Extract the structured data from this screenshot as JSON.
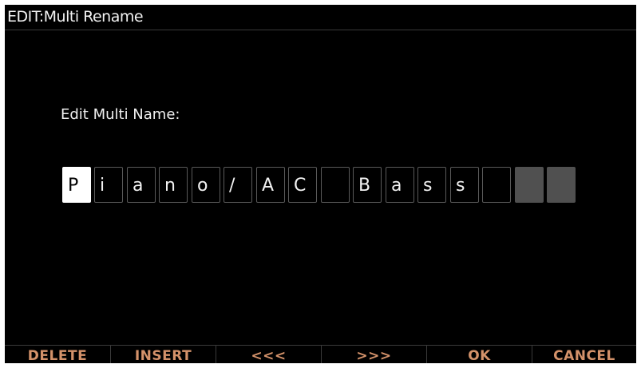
{
  "header": {
    "title": "EDIT:Multi Rename"
  },
  "prompt": {
    "label": "Edit Multi Name:"
  },
  "name_editor": {
    "cursor_index": 0,
    "chars": [
      "P",
      "i",
      "a",
      "n",
      "o",
      "/",
      "A",
      "C",
      " ",
      "B",
      "a",
      "s",
      "s",
      " ",
      "",
      ""
    ]
  },
  "softkeys": [
    {
      "label": "DELETE"
    },
    {
      "label": "INSERT"
    },
    {
      "label": "<<<"
    },
    {
      "label": ">>>"
    },
    {
      "label": "OK"
    },
    {
      "label": "CANCEL"
    }
  ],
  "colors": {
    "background": "#000000",
    "text": "#f2f2f2",
    "softkey_text": "#d4926a",
    "cell_border": "#5a5a5a",
    "cursor_bg": "#ffffff",
    "empty_cell_bg": "#505050"
  }
}
